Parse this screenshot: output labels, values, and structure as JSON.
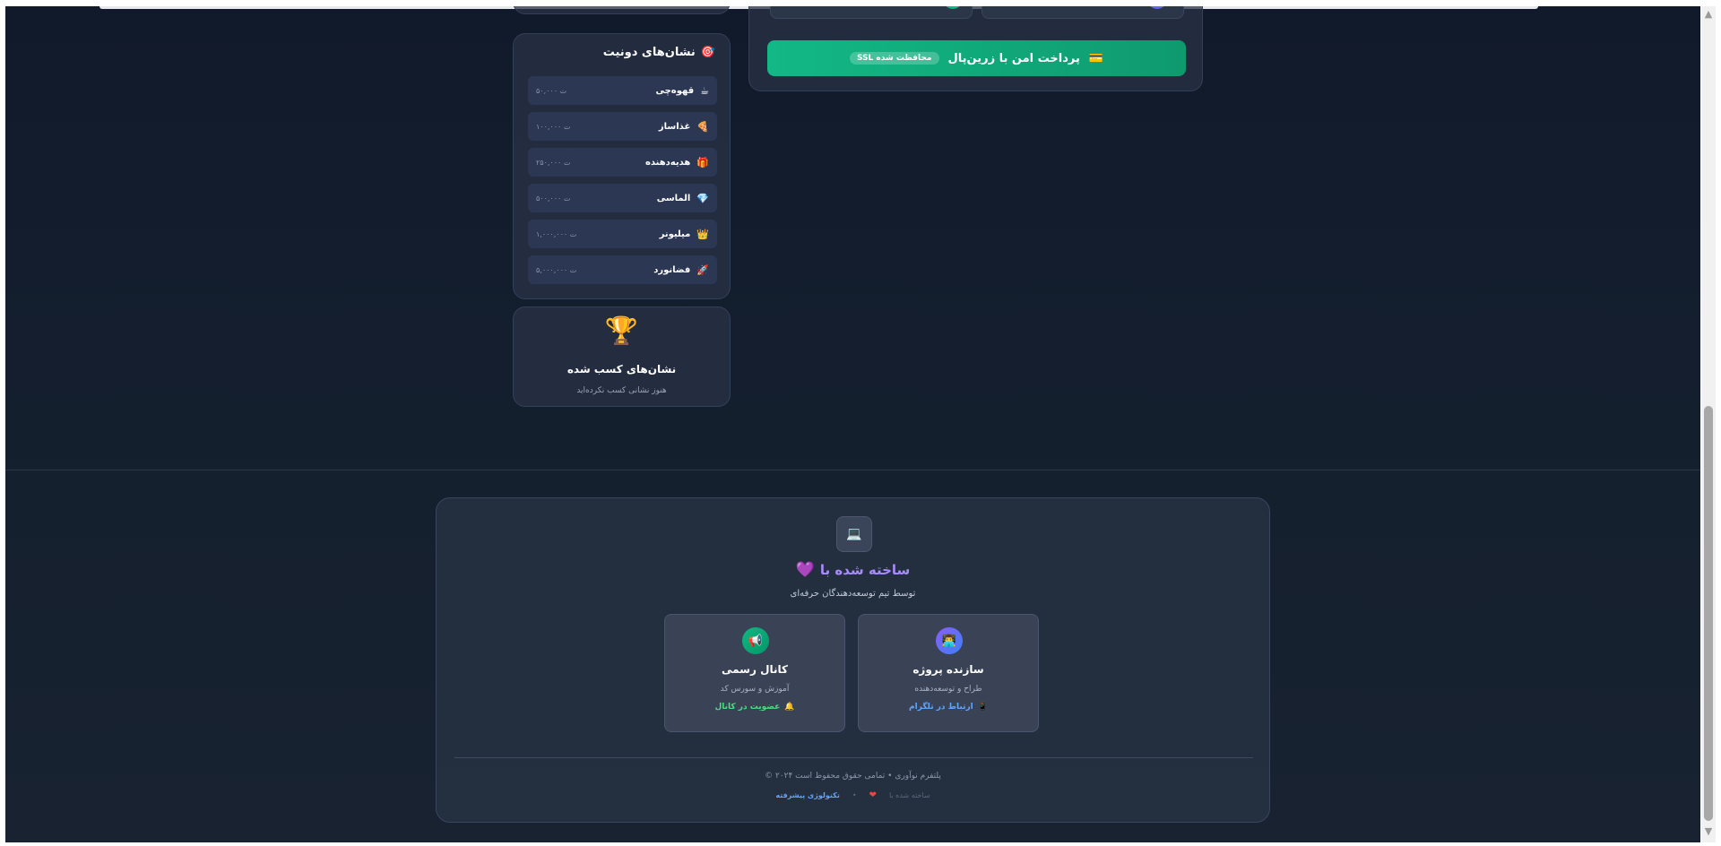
{
  "payment": {
    "button_label": "پرداخت امن با زرین‌پال",
    "ssl_badge": "SSL محافظت شده",
    "icon": "credit-card-icon"
  },
  "badges": {
    "title": "نشان‌های دونیت",
    "title_icon": "target-icon",
    "items": [
      {
        "label": "قهوه‌چی",
        "amount": "۵۰,۰۰۰ ت",
        "icon": "coffee-icon"
      },
      {
        "label": "غذاساز",
        "amount": "۱۰۰,۰۰۰ ت",
        "icon": "pizza-icon"
      },
      {
        "label": "هدیه‌دهنده",
        "amount": "۲۵۰,۰۰۰ ت",
        "icon": "gift-icon"
      },
      {
        "label": "الماسی",
        "amount": "۵۰۰,۰۰۰ ت",
        "icon": "diamond-icon"
      },
      {
        "label": "میلیونر",
        "amount": "۱,۰۰۰,۰۰۰ ت",
        "icon": "crown-icon"
      },
      {
        "label": "فضانورد",
        "amount": "۵,۰۰۰,۰۰۰ ت",
        "icon": "rocket-icon"
      }
    ]
  },
  "earned": {
    "title": "نشان‌های کسب شده",
    "subtitle": "هنوز نشانی کسب نکرده‌اید",
    "icon": "trophy-icon"
  },
  "footer": {
    "made_with": "ساخته شده با",
    "made_sub": "توسط تیم توسعه‌دهندگان حرفه‌ای",
    "creator": {
      "title": "سازنده پروژه",
      "subtitle": "طراح و توسعه‌دهنده",
      "link": "ارتباط در تلگرام"
    },
    "channel": {
      "title": "کانال رسمی",
      "subtitle": "آموزش و سورس کد",
      "link": "عضویت در کانال"
    },
    "copyright": "© ۲۰۲۴ پلتفرم نوآوری • تمامی حقوق محفوظ است",
    "bottom_faded": "ساخته شده با",
    "bottom_link": "تکنولوژی پیشرفته"
  },
  "colors": {
    "accent_green": "#12b886",
    "accent_purple": "#a78bfa",
    "link_blue": "#60a5fa"
  }
}
